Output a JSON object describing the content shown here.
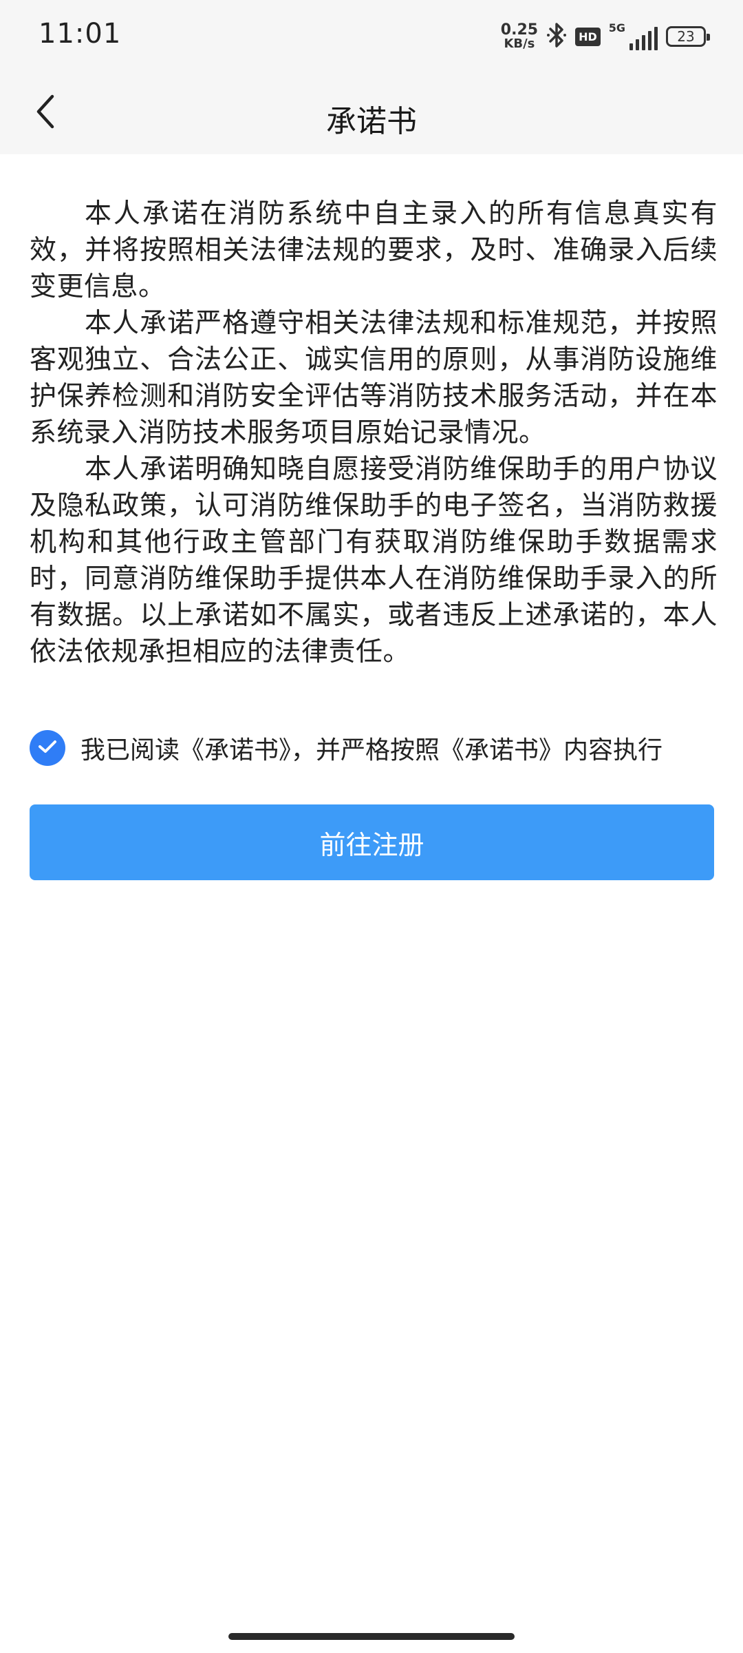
{
  "status_bar": {
    "time": "11:01",
    "net_speed_value": "0.25",
    "net_speed_unit": "KB/s",
    "bluetooth_icon": "bluetooth-icon",
    "hd_badge": "HD",
    "network_type": "5G",
    "battery_level": "23"
  },
  "nav": {
    "back_icon": "chevron-left-icon",
    "title": "承诺书"
  },
  "content": {
    "paragraphs": [
      "本人承诺在消防系统中自主录入的所有信息真实有效，并将按照相关法律法规的要求，及时、准确录入后续变更信息。",
      "本人承诺严格遵守相关法律法规和标准规范，并按照客观独立、合法公正、诚实信用的原则，从事消防设施维护保养检测和消防安全评估等消防技术服务活动，并在本系统录入消防技术服务项目原始记录情况。",
      "本人承诺明确知晓自愿接受消防维保助手的用户协议及隐私政策，认可消防维保助手的电子签名，当消防救援机构和其他行政主管部门有获取消防维保助手数据需求时，同意消防维保助手提供本人在消防维保助手录入的所有数据。以上承诺如不属实，或者违反上述承诺的，本人依法依规承担相应的法律责任。"
    ]
  },
  "agreement": {
    "checked": true,
    "check_icon": "checkmark-icon",
    "label": "我已阅读《承诺书》，并严格按照《承诺书》内容执行"
  },
  "actions": {
    "register_label": "前往注册"
  },
  "colors": {
    "primary_button": "#3d9bf8",
    "checkbox": "#2f7df6",
    "header_bg": "#f6f6f6"
  }
}
